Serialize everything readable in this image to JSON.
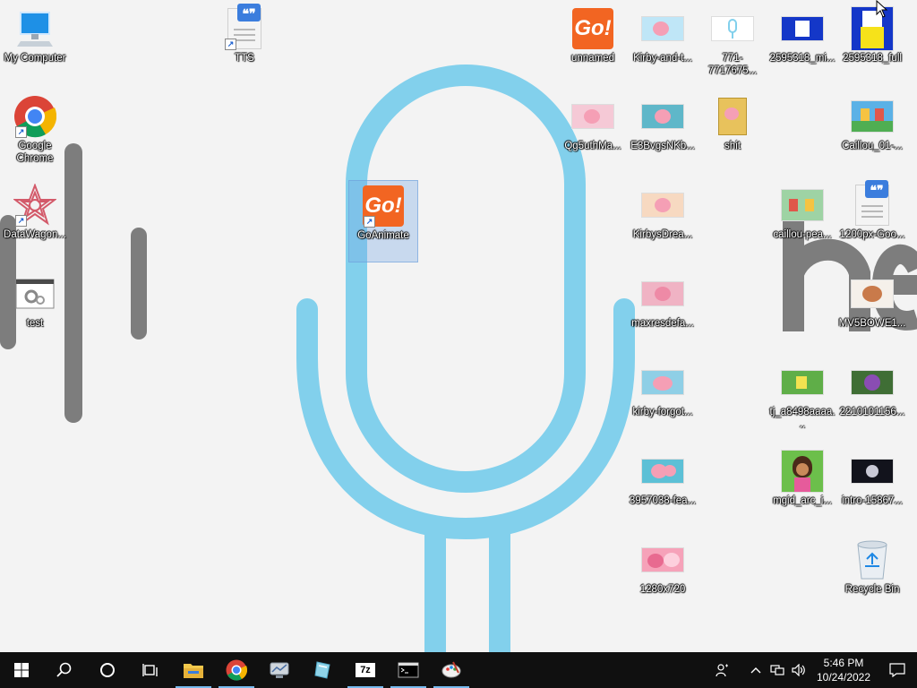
{
  "desktop": {
    "icons": {
      "my_computer": "My Computer",
      "tts": "TTS",
      "unnamed": "unnamed",
      "kirby_and_t": "Kirby-and-t...",
      "file_771": "771-7717675...",
      "mi_2595318": "2595318_mi...",
      "full_2595318": "2595318_full",
      "google_chrome": "Google Chrome",
      "qg5uthma": "Qg5uthMa...",
      "e3bvgsnkb": "E3BvgsNKb...",
      "shit": "shit",
      "caillou_01": "Caillou_01-...",
      "datawagon": "DataWagon...",
      "goanimate": "GoAnimate",
      "kirbysdrea": "KirbysDrea...",
      "caillou_pea": "caillou-pea...",
      "goo_1200px": "1200px-Goo...",
      "test": "test",
      "maxresdefa": "maxresdefa...",
      "mv5bowe1": "MV5BOWE1...",
      "kirby_forgot": "kirby-forgot...",
      "tj_a8498": "tj_a8498aaaa...",
      "file_2210101156": "2210101156...",
      "fea_3957038": "3957038-fea...",
      "mgid_arc": "mgid_arc_i...",
      "intro_15867": "intro-15867...",
      "img_1280x720": "1280x720",
      "recycle_bin": "Recycle Bin"
    },
    "icon_names": {
      "go_logo_text": "Go!"
    }
  },
  "taskbar": {
    "time": "5:46 PM",
    "date": "10/24/2022",
    "sevenzip_label": "7z"
  },
  "colors": {
    "accent": "#76b9ed",
    "go_orange": "#f26522",
    "mic_blue": "#82d0ec",
    "taskbar": "#101010"
  }
}
